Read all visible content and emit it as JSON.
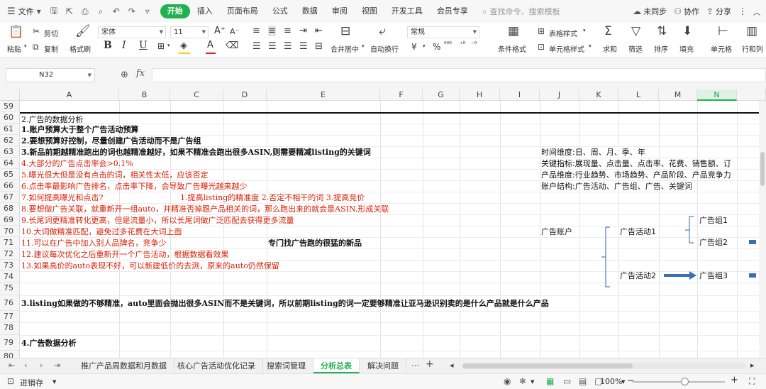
{
  "menubar": {
    "file_label": "文件",
    "tabs": [
      "开始",
      "插入",
      "页面布局",
      "公式",
      "数据",
      "审阅",
      "视图",
      "开发工具",
      "会员专享"
    ],
    "search_placeholder": "查找命令、搜索模板",
    "sync_label": "未同步",
    "collab_label": "协作",
    "share_label": "分享"
  },
  "ribbon": {
    "paste": "粘贴",
    "cut": "剪切",
    "copy": "复制",
    "format_painter": "格式刷",
    "font_name": "宋体",
    "font_size": "11",
    "merge_center": "合并居中",
    "wrap_text": "自动换行",
    "number_format": "常规",
    "conditional_format": "条件格式",
    "table_style": "表格样式",
    "cell_style": "单元格样式",
    "sum": "求和",
    "filter": "筛选",
    "sort": "排序",
    "fill": "填充",
    "cell": "单元格",
    "rowcol": "行和列"
  },
  "formulabar": {
    "name_box": "N32",
    "fx": "fx",
    "formula": ""
  },
  "grid": {
    "columns": [
      "A",
      "B",
      "C",
      "D",
      "E",
      "F",
      "G",
      "H",
      "I",
      "J",
      "K",
      "L",
      "M",
      "N"
    ],
    "selected_column": "N",
    "rows": [
      "59",
      "60",
      "61",
      "62",
      "63",
      "64",
      "65",
      "66",
      "67",
      "68",
      "69",
      "70",
      "71",
      "72",
      "73",
      "74",
      "75",
      "76",
      "77",
      "78",
      "79",
      "80"
    ],
    "cells": {
      "r59": "2.广告的数据分析",
      "r60": "1.账户预算大于整个广告活动预算",
      "r61": "2.要想预算好控制，尽量创建广告活动而不是广告组",
      "r62": "3.新品前期越精准跑出的词也越精准越好，如果不精准会跑出很多ASIN,则需要精减listing的关键词",
      "r63": "4.大部分的广告点击率会>0.1%",
      "r64": "5.曝光很大但是没有点击的词，相关性太低，应该否定",
      "r65": "6.点击率最影响广告排名，点击率下降，会导致广告曝光越来越少",
      "r66": "7.如何提高曝光和点击?",
      "r66_c": "1.提高listing的精准度   2.否定不相干的词   3.提高竞价",
      "r67": "8.要想做广告关联，就重新开一组auto，并精准否掉跟产品相关的词，那么跑出来的就会是ASIN,形成关联",
      "r68": "9.长尾词更精准转化更高，但是流量小，所以长尾词做广泛匹配去获得更多流量",
      "r69": "10.大词做精准匹配，避免过多花费在大词上面",
      "r70": "11.可以在广告中加入别人品牌名，竞争少",
      "r70_e": "专门找广告跑的很猛的新品",
      "r71": "12.建议每次优化之后重新开一个广告活动，根据数据看效果",
      "r72": "13.如果高价的auto表现不好，可以新建低价的去测，原来的auto仍然保留",
      "r76": "3.listing如果做的不够精准，auto里面会抛出很多ASIN而不是关键词，所以前期listing的词一定要够精准让亚马逊识别卖的是什么产品就是什么产品",
      "r79": "4.广告数据分析",
      "j62": "时间维度:日、周、月、季、年",
      "j63": "关键指标:展现量、点击量、点击率、花费、销售额、订",
      "j64": "产品维度:行业趋势、市场趋势、产品阶段、产品竞争力",
      "j65": "账户结构:广告活动、广告组、广告、关键词",
      "j69": "广告账户",
      "l69": "广告活动1",
      "l73": "广告活动2",
      "n68": "广告组1",
      "n70": "广告组2",
      "n73": "广告组3"
    }
  },
  "sheets": {
    "tabs": [
      "推广产品周数据和月数据",
      "核心广告活动优化记录",
      "搜索词管理",
      "分析总表",
      "解决问题"
    ],
    "active": "分析总表"
  },
  "statusbar": {
    "autosave": "进销存",
    "zoom": "100%"
  },
  "colors": {
    "accent": "#21b14e",
    "red_text": "#d81e06",
    "arrow_blue": "#3a6fb0"
  }
}
